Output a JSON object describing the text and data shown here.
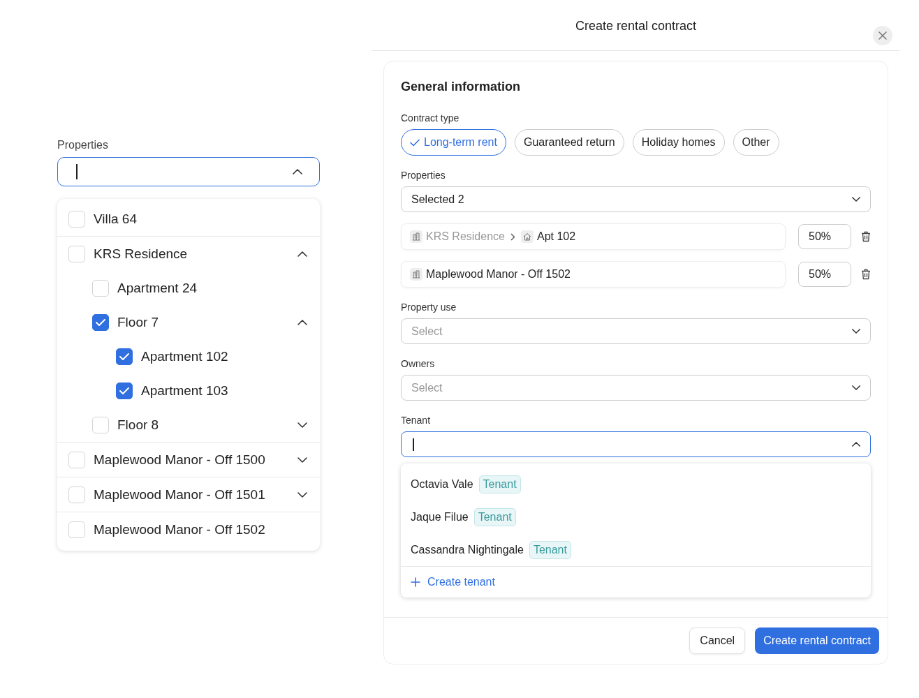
{
  "properties_picker": {
    "label": "Properties",
    "expanded": true,
    "tree": [
      {
        "name": "Villa 64",
        "kind": "unit",
        "checked": false
      },
      {
        "name": "KRS Residence",
        "kind": "group",
        "checked": false,
        "expanded": true,
        "children": [
          {
            "name": "Apartment 24",
            "kind": "unit",
            "checked": false
          },
          {
            "name": "Floor 7",
            "kind": "group",
            "checked": true,
            "expanded": true,
            "children": [
              {
                "name": "Apartment 102",
                "kind": "unit",
                "checked": true
              },
              {
                "name": "Apartment 103",
                "kind": "unit",
                "checked": true
              }
            ]
          },
          {
            "name": "Floor 8",
            "kind": "group",
            "checked": false,
            "expanded": false
          }
        ]
      },
      {
        "name": "Maplewood Manor - Off 1500",
        "kind": "group",
        "checked": false,
        "expanded": false
      },
      {
        "name": "Maplewood Manor - Off 1501",
        "kind": "group",
        "checked": false,
        "expanded": false
      },
      {
        "name": "Maplewood Manor - Off 1502",
        "kind": "unit",
        "checked": false
      }
    ]
  },
  "dialog": {
    "title": "Create rental contract",
    "section_title": "General information",
    "contract_type": {
      "label": "Contract type",
      "options": [
        {
          "label": "Long-term rent",
          "selected": true
        },
        {
          "label": "Guaranteed return",
          "selected": false
        },
        {
          "label": "Holiday homes",
          "selected": false
        },
        {
          "label": "Other",
          "selected": false
        }
      ]
    },
    "properties": {
      "label": "Properties",
      "value": "Selected 2",
      "expanded": false,
      "allocations": [
        {
          "path": [
            {
              "kind": "building",
              "text": "KRS Residence",
              "muted": true
            },
            {
              "kind": "home",
              "text": "Apt 102",
              "muted": false
            }
          ],
          "share": "50%"
        },
        {
          "path": [
            {
              "kind": "building",
              "text": "Maplewood Manor - Off 1502",
              "muted": false
            }
          ],
          "share": "50%"
        }
      ]
    },
    "property_use": {
      "label": "Property use",
      "placeholder": "Select",
      "expanded": false
    },
    "owners": {
      "label": "Owners",
      "placeholder": "Select",
      "expanded": false
    },
    "tenant": {
      "label": "Tenant",
      "expanded": true,
      "options": [
        {
          "name": "Octavia Vale",
          "badge": "Tenant"
        },
        {
          "name": "Jaque Filue",
          "badge": "Tenant"
        },
        {
          "name": "Cassandra Nightingale",
          "badge": "Tenant"
        }
      ],
      "create_label": "Create tenant"
    },
    "buttons": [
      {
        "label": "Cancel",
        "kind": "secondary"
      },
      {
        "label": "Create rental contract",
        "kind": "primary"
      }
    ]
  }
}
